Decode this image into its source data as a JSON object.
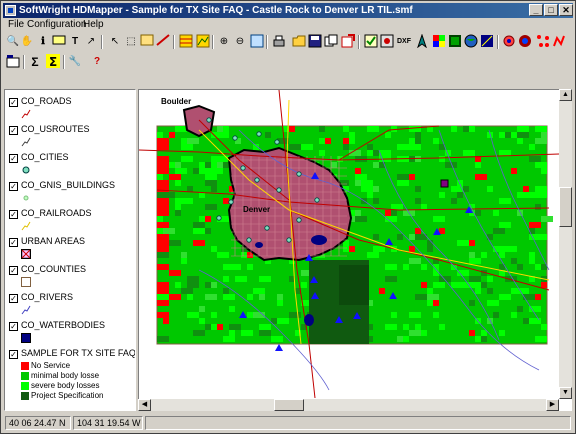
{
  "window": {
    "title": "SoftWright HDMapper - Sample for TX Site FAQ - Castle Rock to Denver LR TIL.smf"
  },
  "title_buttons": {
    "minimize": "_",
    "maximize": "□",
    "close": "✕"
  },
  "menu": [
    {
      "label": "File",
      "key": "F"
    },
    {
      "label": "Configuration",
      "key": "C"
    },
    {
      "label": "Help",
      "key": "H"
    }
  ],
  "toolbar1": [
    "zoom-tool-icon",
    "hand-tool-icon",
    "info-tool-icon",
    "label-tool-icon",
    "text-tool-icon",
    "line-tool-icon",
    "pointer-tool-icon",
    "select-tool-icon",
    "layer-tool-icon",
    "distance-tool-icon",
    "grid-tool-icon",
    "profile-tool-icon",
    "zoom-in-icon",
    "zoom-out-icon",
    "print-icon",
    "open-icon",
    "save-icon",
    "copy-icon",
    "export-icon",
    "check-icon",
    "settings-icon",
    "dxf-icon",
    "compass-icon",
    "color-icon",
    "shade-icon",
    "globe-icon",
    "network-icon",
    "site-icon",
    "route-icon"
  ],
  "dxf_label": "DXF",
  "toolbar2": [
    "new-layer-icon",
    "sum-icon",
    "sum-select-icon",
    "wrench-icon",
    "help-question-icon"
  ],
  "layers": [
    {
      "name": "CO_ROADS",
      "symbol": "road-line-symbol",
      "checked": true
    },
    {
      "name": "CO_USROUTES",
      "symbol": "route-line-symbol",
      "checked": true
    },
    {
      "name": "CO_CITIES",
      "symbol": "city-point-symbol",
      "checked": true
    },
    {
      "name": "CO_GNIS_BUILDINGS",
      "symbol": "building-point-symbol",
      "checked": true
    },
    {
      "name": "CO_RAILROADS",
      "symbol": "rail-line-symbol",
      "checked": true
    },
    {
      "name": "URBAN AREAS",
      "symbol": "urban-area-symbol",
      "checked": true
    },
    {
      "name": "CO_COUNTIES",
      "symbol": "county-area-symbol",
      "checked": true
    },
    {
      "name": "CO_RIVERS",
      "symbol": "river-line-symbol",
      "checked": true
    },
    {
      "name": "CO_WATERBODIES",
      "symbol": "water-area-symbol",
      "checked": true
    },
    {
      "name": "SAMPLE FOR TX SITE FAQ - CAS",
      "symbol": "coverage-symbol",
      "checked": true
    }
  ],
  "coverage_legend": [
    {
      "label": "No Service",
      "color": "#ff0000"
    },
    {
      "label": "minimal body losse",
      "color": "#00c800"
    },
    {
      "label": "severe body losses",
      "color": "#00ff00"
    },
    {
      "label": "Project Specification",
      "color": "#105a10"
    }
  ],
  "map": {
    "labels": {
      "boulder": "Boulder",
      "denver": "Denver"
    }
  },
  "status": {
    "latitude": "40 06 24.47 N",
    "longitude": "104 31 19.54 W"
  }
}
